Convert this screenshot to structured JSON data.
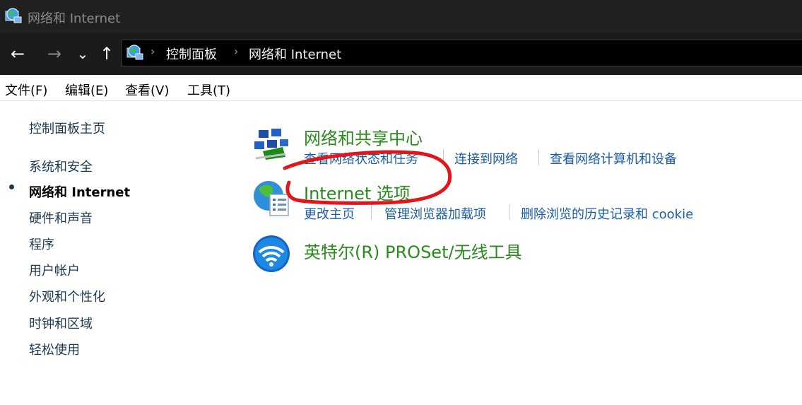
{
  "window": {
    "title": "网络和 Internet"
  },
  "nav": {
    "back": "←",
    "forward": "→",
    "recent": "⌄",
    "up": "↑"
  },
  "address": {
    "sep1": "›",
    "crumb1": "控制面板",
    "sep2": "›",
    "crumb2": "网络和 Internet"
  },
  "menu": {
    "file": "文件(F)",
    "edit": "编辑(E)",
    "view": "查看(V)",
    "tools": "工具(T)"
  },
  "sidebar": {
    "home": "控制面板主页",
    "items": [
      "系统和安全",
      "网络和 Internet",
      "硬件和声音",
      "程序",
      "用户帐户",
      "外观和个性化",
      "时钟和区域",
      "轻松使用"
    ]
  },
  "categories": [
    {
      "title": "网络和共享中心",
      "links": [
        "查看网络状态和任务",
        "连接到网络",
        "查看网络计算机和设备"
      ]
    },
    {
      "title": "Internet 选项",
      "links": [
        "更改主页",
        "管理浏览器加载项",
        "删除浏览的历史记录和 cookie"
      ]
    },
    {
      "title": "英特尔(R) PROSet/无线工具",
      "links": []
    }
  ],
  "colors": {
    "category_title": "#2b8a1e",
    "task_link": "#1a5ca8",
    "annotation": "#e0161b",
    "titlebar": "#202020",
    "navbar": "#1b1b1b"
  }
}
